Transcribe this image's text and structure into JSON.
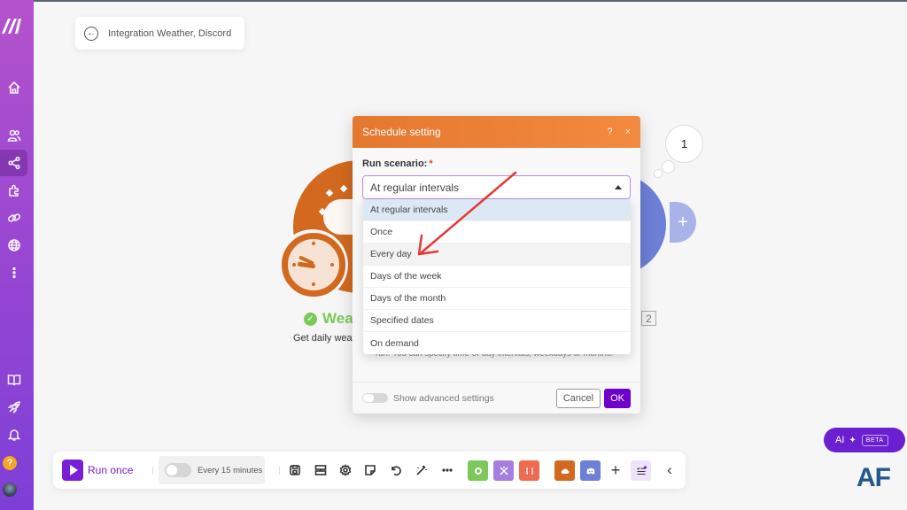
{
  "app": {
    "logo_text": "M",
    "breadcrumb": {
      "title": "Integration Weather, Discord"
    }
  },
  "sidebar": {
    "items": [
      {
        "name": "home",
        "icon": "home-icon"
      },
      {
        "name": "team",
        "icon": "users-icon"
      },
      {
        "name": "scenarios",
        "icon": "share-icon",
        "active": true
      },
      {
        "name": "apps",
        "icon": "puzzle-icon"
      },
      {
        "name": "connections",
        "icon": "link-icon"
      },
      {
        "name": "webhooks",
        "icon": "globe-icon"
      },
      {
        "name": "more",
        "icon": "more-vertical-icon"
      },
      {
        "name": "docs",
        "icon": "book-icon"
      },
      {
        "name": "whats-new",
        "icon": "rocket-icon"
      },
      {
        "name": "notifications",
        "icon": "bell-icon"
      }
    ],
    "help_label": "?"
  },
  "canvas": {
    "weather_module": {
      "title": "Weather",
      "title_visible": "Wea",
      "description_visible": "Get daily wea",
      "status": "ok",
      "color": "#d2691e"
    },
    "discord_module": {
      "color": "#6e7fd6",
      "badge": "2",
      "bubble_count": "1",
      "add_label": "+"
    }
  },
  "modal": {
    "title": "Schedule setting",
    "help_label": "?",
    "close_label": "×",
    "field_label": "Run scenario:",
    "required_mark": "*",
    "selected_value": "At regular intervals",
    "options": [
      {
        "label": "At regular intervals",
        "state": "selected"
      },
      {
        "label": "Once",
        "state": ""
      },
      {
        "label": "Every day",
        "state": "hover"
      },
      {
        "label": "Days of the week",
        "state": ""
      },
      {
        "label": "Days of the month",
        "state": ""
      },
      {
        "label": "Specified dates",
        "state": ""
      },
      {
        "label": "On demand",
        "state": ""
      }
    ],
    "help_text": "run. You can specify time-of-day intervals, weekdays or months.",
    "advanced_label": "Show advanced settings",
    "advanced_enabled": false,
    "cancel_label": "Cancel",
    "ok_label": "OK"
  },
  "toolbar": {
    "run_once_label": "Run once",
    "schedule_label": "Every 15 minutes",
    "schedule_enabled": false,
    "icons": [
      "save-icon",
      "scenario-io-icon",
      "settings-icon",
      "notes-icon",
      "undo-icon",
      "auto-align-icon",
      "more-icon"
    ],
    "tools": [
      {
        "name": "tools",
        "color": "#7cc85a"
      },
      {
        "name": "flow-control",
        "color": "#a57fe0"
      },
      {
        "name": "text-parser",
        "color": "#ef6b4f"
      },
      {
        "name": "weather",
        "color": "#d2691e"
      },
      {
        "name": "discord",
        "color": "#6e7fd6"
      }
    ],
    "add_label": "+",
    "collapse_label": "‹"
  },
  "ai": {
    "label": "AI",
    "beta_label": "BETA"
  },
  "watermark": "AF",
  "colors": {
    "accent": "#6d00cc",
    "modal_header": "#e4782f",
    "sidebar": "#9a48d2"
  }
}
